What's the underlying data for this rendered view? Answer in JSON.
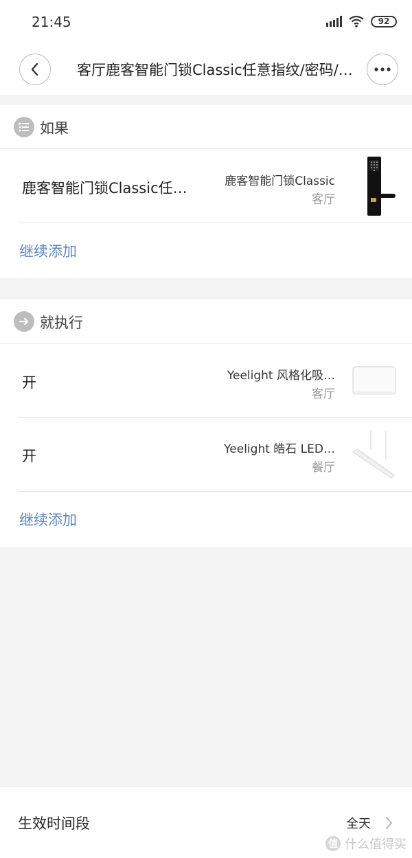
{
  "status_bar": {
    "time": "21:45",
    "battery": "92",
    "icons": [
      "signal-icon",
      "wifi-icon",
      "battery-icon"
    ]
  },
  "header": {
    "title": "客厅鹿客智能门锁Classic任意指纹/密码/…",
    "back_icon": "chevron-left-icon",
    "more_icon": "more-dots-icon"
  },
  "if_section": {
    "title": "如果",
    "icon": "list-icon",
    "condition": {
      "label": "鹿客智能门锁Classic任…",
      "device": "鹿客智能门锁Classic",
      "room": "客厅",
      "thumb": "door-lock-image"
    },
    "add_more": "继续添加"
  },
  "do_section": {
    "title": "就执行",
    "icon": "arrow-right-icon",
    "actions": [
      {
        "label": "开",
        "device": "Yeelight 风格化吸…",
        "room": "客厅",
        "thumb": "ceiling-light-image"
      },
      {
        "label": "开",
        "device": "Yeelight 皓石 LED…",
        "room": "餐厅",
        "thumb": "pendant-light-image"
      }
    ],
    "add_more": "继续添加"
  },
  "schedule": {
    "label": "生效时间段",
    "value": "全天",
    "icon": "chevron-right-icon"
  },
  "watermark": {
    "badge": "值",
    "text": "什么值得买"
  },
  "colors": {
    "link": "#5b85c8",
    "section_icon": "#bdbdbd",
    "background": "#f4f4f4"
  }
}
